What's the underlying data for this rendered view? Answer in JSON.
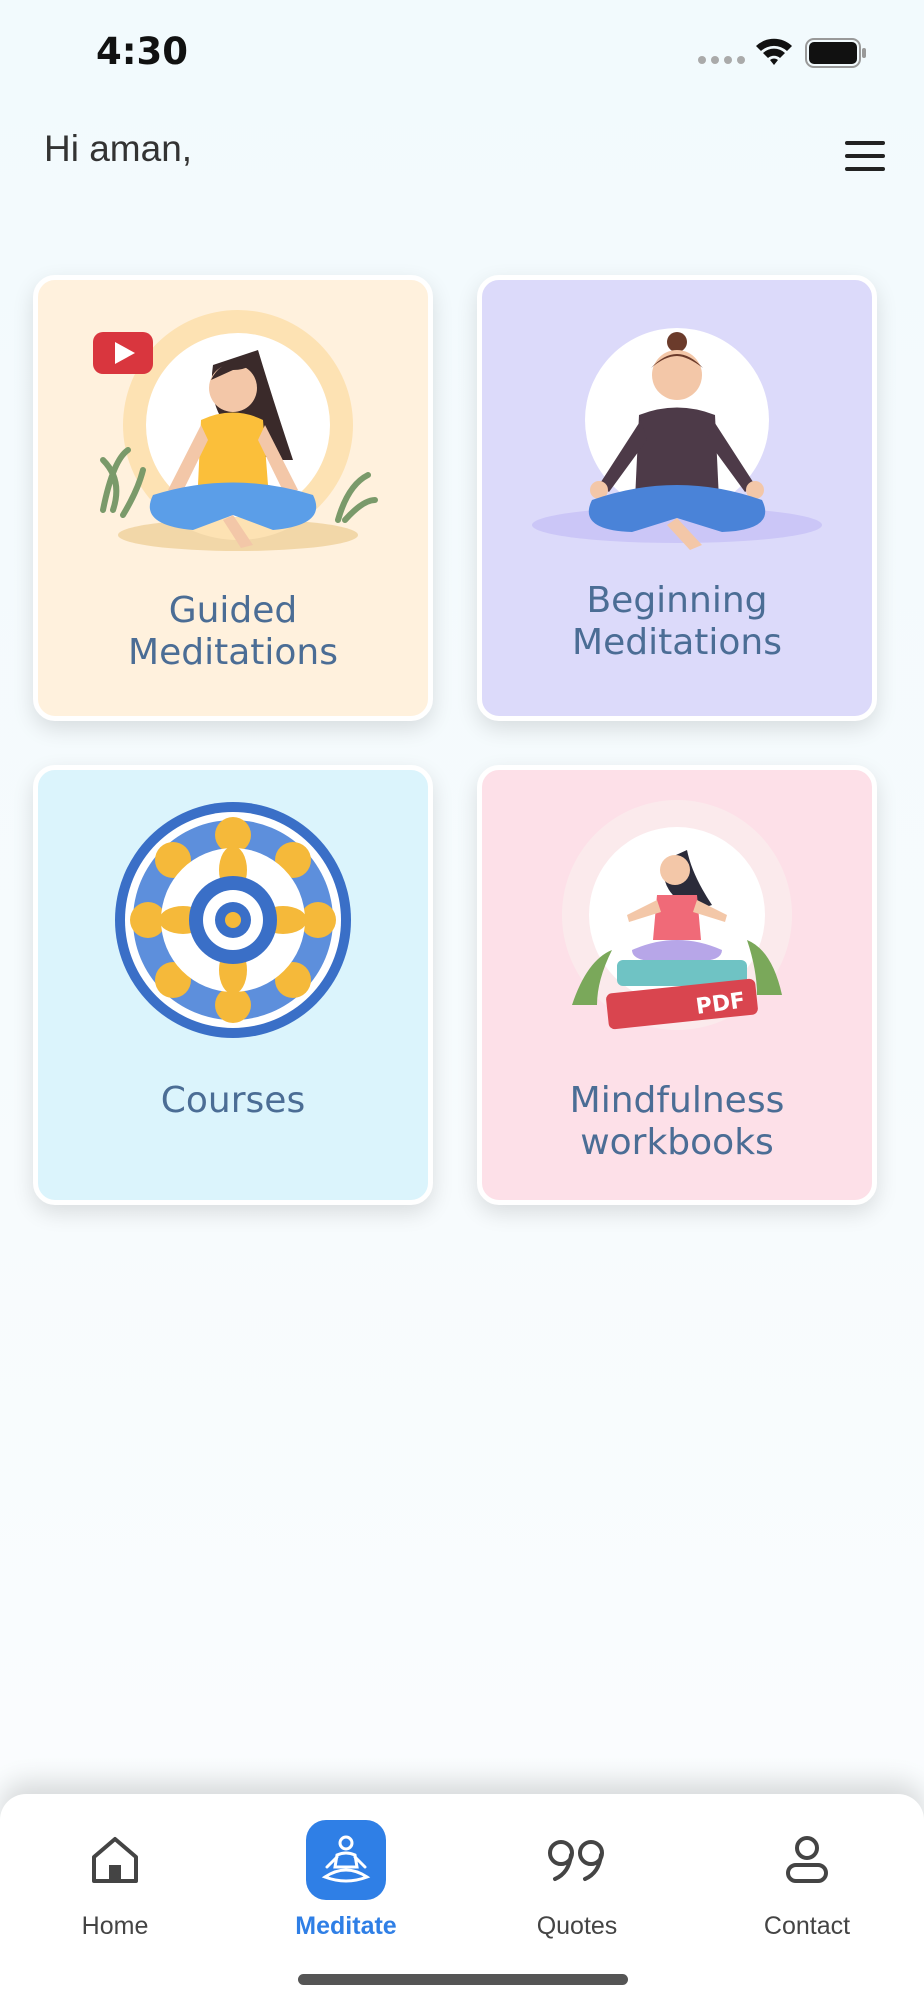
{
  "status_bar": {
    "time": "4:30"
  },
  "header": {
    "greeting": "Hi aman,"
  },
  "cards": [
    {
      "line1": "Guided",
      "line2": "Meditations",
      "icon": "guided-meditation-illustration",
      "bg": "#fff1dd"
    },
    {
      "line1": "Beginning",
      "line2": "Meditations",
      "icon": "beginning-meditation-illustration",
      "bg": "#dcdafa"
    },
    {
      "line1": "Courses",
      "icon": "mandala-illustration",
      "bg": "#dbf4fc"
    },
    {
      "line1": "Mindfulness",
      "line2": "workbooks",
      "icon": "pdf-workbook-illustration",
      "bg": "#fde0e8"
    }
  ],
  "tab_bar": {
    "items": [
      {
        "label": "Home",
        "icon": "home-icon",
        "active": false
      },
      {
        "label": "Meditate",
        "icon": "meditate-icon",
        "active": true
      },
      {
        "label": "Quotes",
        "icon": "quotes-icon",
        "active": false
      },
      {
        "label": "Contact",
        "icon": "contact-icon",
        "active": false
      }
    ],
    "accent": "#2f7fe6"
  },
  "colors": {
    "card_text": "#4b6d95",
    "background": "#f2fafd"
  }
}
